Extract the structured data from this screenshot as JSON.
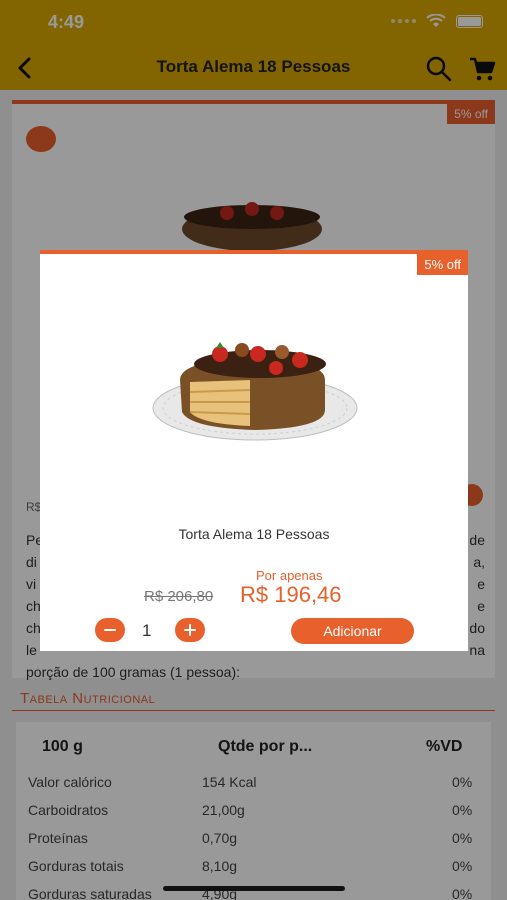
{
  "status": {
    "time": "4:49"
  },
  "header": {
    "title": "Torta Alema 18 Pessoas",
    "icons": [
      "back-arrow-icon",
      "search-icon",
      "cart-icon"
    ]
  },
  "background_card": {
    "badge": "5% off",
    "price_hint": "R$",
    "description_lines": [
      "Pe",
      "di",
      "vi",
      "ch",
      "ch",
      "le",
      "porção de 100 gramas (1 pessoa):"
    ],
    "description_right": [
      "de",
      "a,",
      "e",
      "e",
      "do",
      "na"
    ]
  },
  "nutrition": {
    "title": "Tabela Nutricional",
    "headers": [
      "100 g",
      "Qtde por p...",
      "%VD"
    ],
    "rows": [
      {
        "name": "Valor calórico",
        "qty": "154 Kcal",
        "vd": "0%"
      },
      {
        "name": "Carboidratos",
        "qty": "21,00g",
        "vd": "0%"
      },
      {
        "name": "Proteínas",
        "qty": "0,70g",
        "vd": "0%"
      },
      {
        "name": "Gorduras totais",
        "qty": "8,10g",
        "vd": "0%"
      },
      {
        "name": "Gorduras saturadas",
        "qty": "4,90g",
        "vd": "0%"
      }
    ]
  },
  "modal": {
    "badge": "5% off",
    "product_name": "Torta Alema 18 Pessoas",
    "label_offer": "Por apenas",
    "old_price": "R$ 206,80",
    "new_price": "R$ 196,46",
    "quantity": "1",
    "add_label": "Adicionar"
  },
  "colors": {
    "header": "#d9a800",
    "accent": "#e8602c"
  }
}
